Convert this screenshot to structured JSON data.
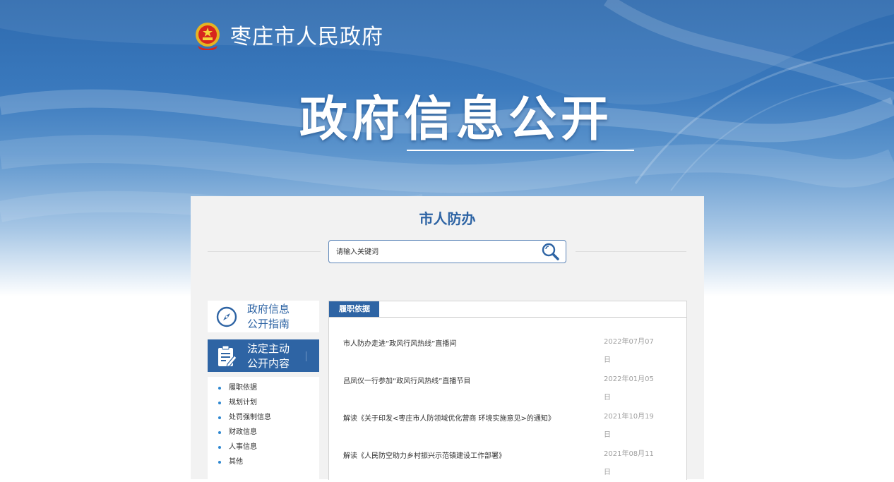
{
  "header": {
    "site_name": "枣庄市人民政府",
    "banner_title": "政府信息公开",
    "logo_icon": "national-emblem-icon"
  },
  "department": {
    "name": "市人防办"
  },
  "search": {
    "placeholder": "请输入关键词",
    "value": "",
    "icon": "search-icon"
  },
  "sidebar": {
    "guide": {
      "line1": "政府信息",
      "line2": "公开指南",
      "icon": "compass-icon"
    },
    "active": {
      "line1": "法定主动",
      "line2": "公开内容",
      "icon": "document-edit-icon"
    },
    "items": [
      {
        "label": "履职依据"
      },
      {
        "label": "规划计划"
      },
      {
        "label": "处罚强制信息"
      },
      {
        "label": "财政信息"
      },
      {
        "label": "人事信息"
      },
      {
        "label": "其他"
      }
    ]
  },
  "content": {
    "tab_label": "履职依据",
    "rows": [
      {
        "title": "市人防办走进“政风行风热线”直播间",
        "date": "2022年07月07日"
      },
      {
        "title": "吕凤仪一行参加“政风行风热线”直播节目",
        "date": "2022年01月05日"
      },
      {
        "title": "解读《关于印发<枣庄市人防领域优化营商 环境实施意见>的通知》",
        "date": "2021年10月19日"
      },
      {
        "title": "解读《人民防空助力乡村振兴示范镇建设工作部署》",
        "date": "2021年08月11日"
      }
    ]
  },
  "colors": {
    "brand_blue": "#2e64a4",
    "bullet": "#2e87d0",
    "date_gray": "#a0a0a0"
  }
}
